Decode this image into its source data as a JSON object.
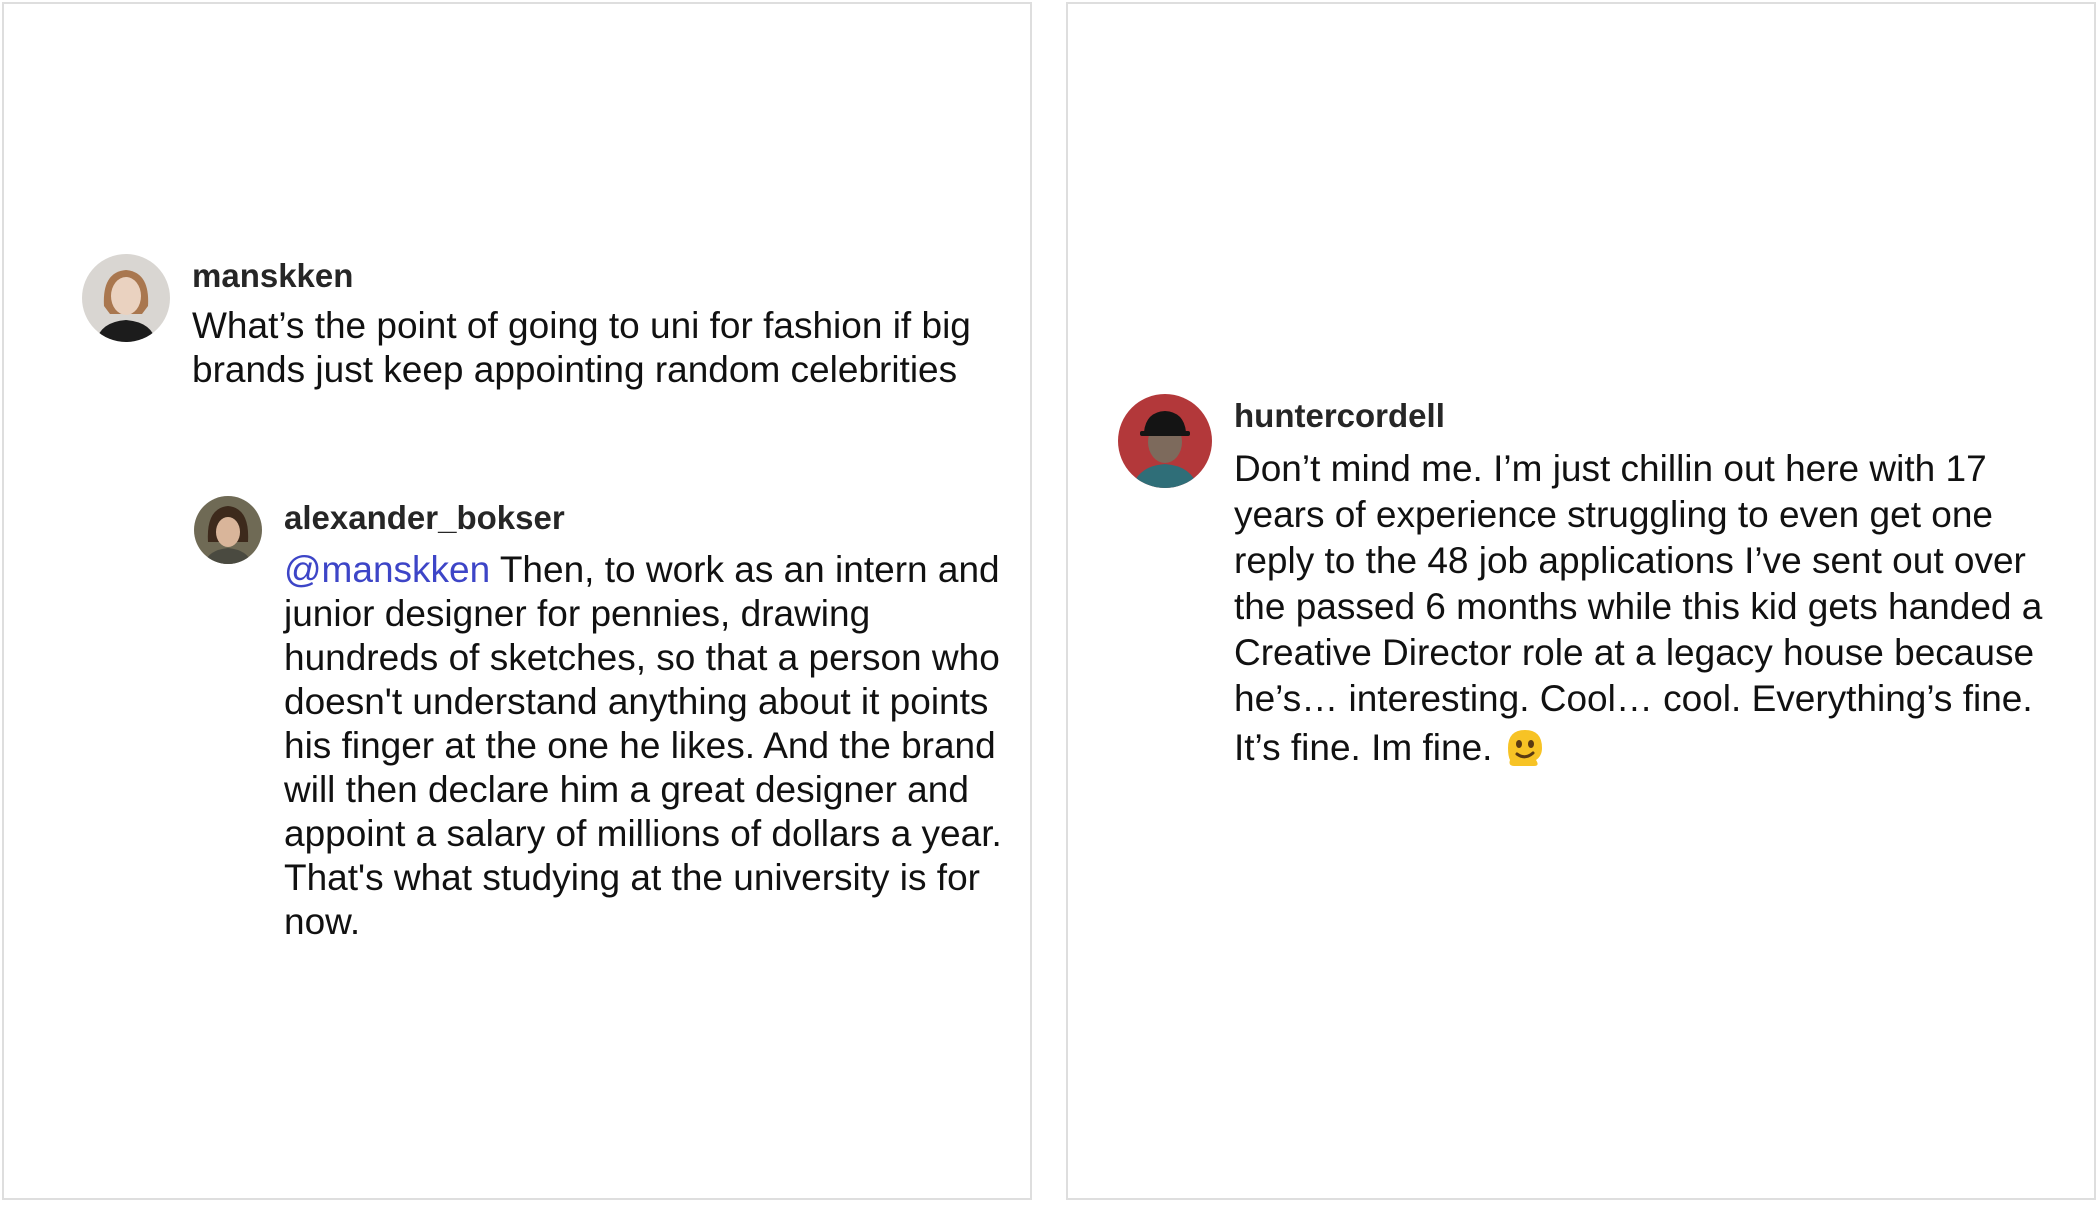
{
  "left_panel": {
    "comment": {
      "username": "manskken",
      "text": "What’s the point of going to uni for fashion if big brands just keep appointing random celebrities",
      "avatar_icon": "person-avatar-icon"
    },
    "reply": {
      "username": "alexander_bokser",
      "mention": "@manskken",
      "text": " Then, to work as an intern and junior designer for pennies, drawing hundreds of sketches, so that a person who doesn't understand anything about it points his finger at the one he likes. And the brand will then declare him a great designer and appoint a salary of millions of dollars a year. That's what studying at the university is for now.",
      "avatar_icon": "person-avatar-icon"
    }
  },
  "right_panel": {
    "comment": {
      "username": "huntercordell",
      "text": "Don’t mind me. I’m just chillin out here with 17 years of experience struggling to even get one reply to the 48 job applications I’ve sent out over the passed 6 months while this kid gets handed a Creative Director role at a legacy house because he’s… interesting. Cool… cool. Everything’s fine. It’s fine. Im fine.",
      "emoji_icon": "melting-face-emoji-icon",
      "avatar_icon": "person-avatar-icon"
    }
  },
  "colors": {
    "mention": "#3d45c7",
    "text": "#111111",
    "username": "#262626",
    "border": "#dedede"
  }
}
